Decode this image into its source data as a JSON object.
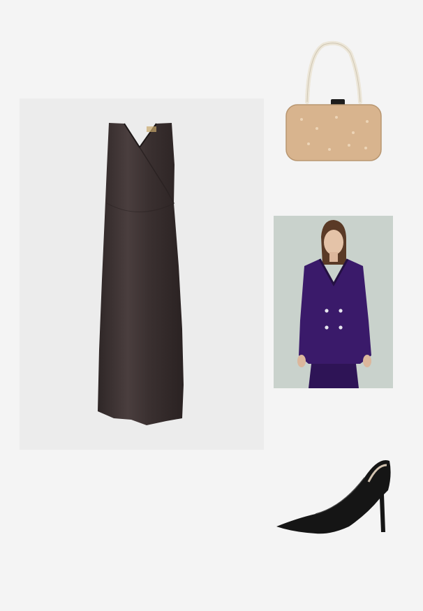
{
  "board": {
    "background": "#f4f4f4",
    "products": [
      {
        "name": "dress",
        "color": "#3b3232"
      },
      {
        "name": "clutch-bag",
        "color": "#d8b48e"
      },
      {
        "name": "velvet-blazer-suit",
        "color": "#3a1a6a"
      },
      {
        "name": "pointed-pumps",
        "color": "#151515"
      }
    ]
  }
}
